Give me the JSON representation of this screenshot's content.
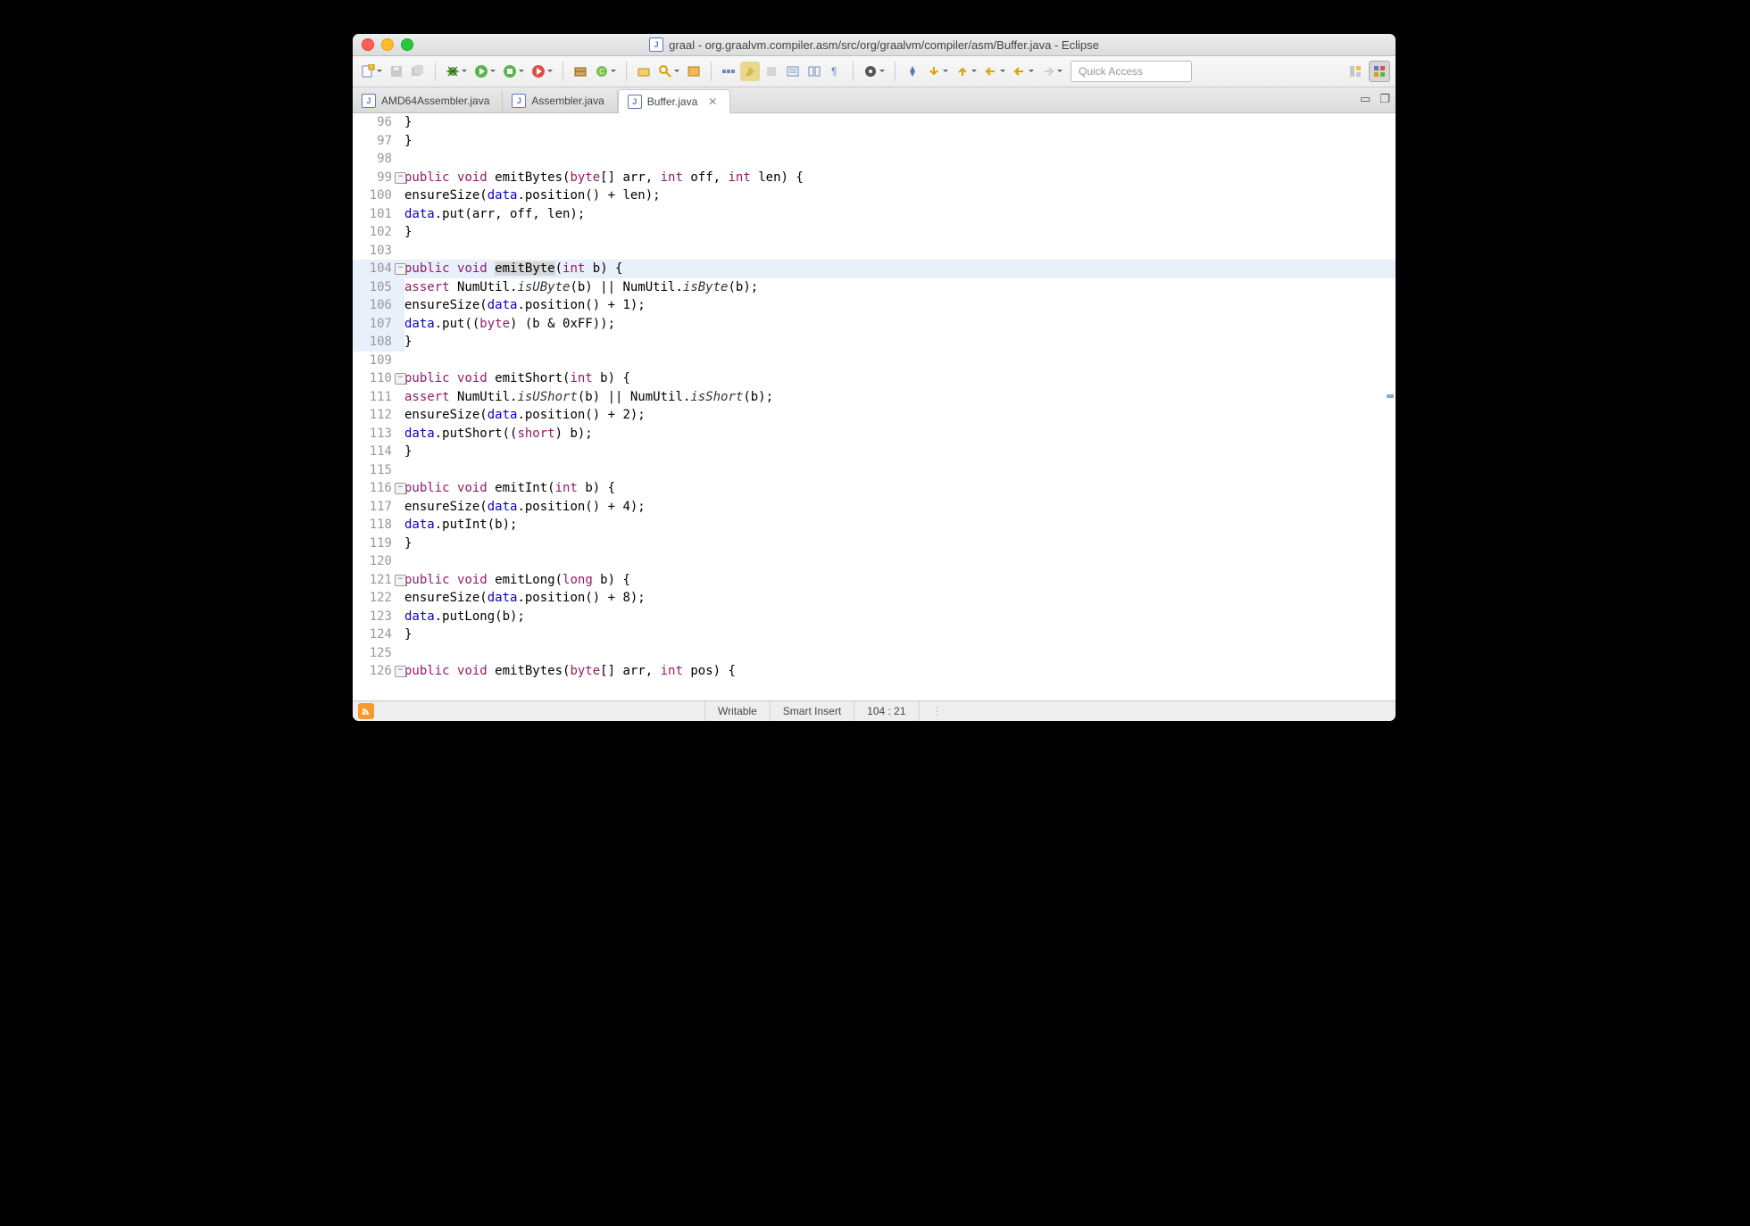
{
  "window_title": "graal - org.graalvm.compiler.asm/src/org/graalvm/compiler/asm/Buffer.java - Eclipse",
  "quick_access": "Quick Access",
  "tabs": [
    {
      "label": "AMD64Assembler.java",
      "active": false
    },
    {
      "label": "Assembler.java",
      "active": false
    },
    {
      "label": "Buffer.java",
      "active": true
    }
  ],
  "status": {
    "writable": "Writable",
    "insert": "Smart Insert",
    "pos": "104 : 21"
  },
  "lines": [
    {
      "n": "96",
      "mod": false,
      "fold": false,
      "hl": false,
      "html": "            }"
    },
    {
      "n": "97",
      "mod": false,
      "fold": false,
      "hl": false,
      "html": "        }"
    },
    {
      "n": "98",
      "mod": false,
      "fold": false,
      "hl": false,
      "html": ""
    },
    {
      "n": "99",
      "mod": false,
      "fold": true,
      "hl": false,
      "html": "        <span class='k'>public</span> <span class='k'>void</span> emitBytes(<span class='k'>byte</span>[] arr, <span class='k'>int</span> off, <span class='k'>int</span> len) {"
    },
    {
      "n": "100",
      "mod": false,
      "fold": false,
      "hl": false,
      "html": "            ensureSize(<span class='f'>data</span>.position() + len);"
    },
    {
      "n": "101",
      "mod": false,
      "fold": false,
      "hl": false,
      "html": "            <span class='f'>data</span>.put(arr, off, len);"
    },
    {
      "n": "102",
      "mod": false,
      "fold": false,
      "hl": false,
      "html": "        }"
    },
    {
      "n": "103",
      "mod": false,
      "fold": false,
      "hl": false,
      "html": ""
    },
    {
      "n": "104",
      "mod": true,
      "fold": true,
      "hl": true,
      "html": "        <span class='k'>public</span> <span class='k'>void</span> <span class='sel'>emitByte</span>(<span class='k'>int</span> b) {"
    },
    {
      "n": "105",
      "mod": true,
      "fold": false,
      "hl": false,
      "html": "            <span class='k'>assert</span> NumUtil.<span class='m'>isUByte</span>(b) || NumUtil.<span class='m'>isByte</span>(b);"
    },
    {
      "n": "106",
      "mod": true,
      "fold": false,
      "hl": false,
      "html": "            ensureSize(<span class='f'>data</span>.position() + 1);"
    },
    {
      "n": "107",
      "mod": true,
      "fold": false,
      "hl": false,
      "html": "            <span class='f'>data</span>.put((<span class='k'>byte</span>) (b & 0xFF));"
    },
    {
      "n": "108",
      "mod": true,
      "fold": false,
      "hl": false,
      "html": "        }"
    },
    {
      "n": "109",
      "mod": false,
      "fold": false,
      "hl": false,
      "html": ""
    },
    {
      "n": "110",
      "mod": false,
      "fold": true,
      "hl": false,
      "html": "        <span class='k'>public</span> <span class='k'>void</span> emitShort(<span class='k'>int</span> b) {"
    },
    {
      "n": "111",
      "mod": false,
      "fold": false,
      "hl": false,
      "html": "            <span class='k'>assert</span> NumUtil.<span class='m'>isUShort</span>(b) || NumUtil.<span class='m'>isShort</span>(b);"
    },
    {
      "n": "112",
      "mod": false,
      "fold": false,
      "hl": false,
      "html": "            ensureSize(<span class='f'>data</span>.position() + 2);"
    },
    {
      "n": "113",
      "mod": false,
      "fold": false,
      "hl": false,
      "html": "            <span class='f'>data</span>.putShort((<span class='k'>short</span>) b);"
    },
    {
      "n": "114",
      "mod": false,
      "fold": false,
      "hl": false,
      "html": "        }"
    },
    {
      "n": "115",
      "mod": false,
      "fold": false,
      "hl": false,
      "html": ""
    },
    {
      "n": "116",
      "mod": false,
      "fold": true,
      "hl": false,
      "html": "        <span class='k'>public</span> <span class='k'>void</span> emitInt(<span class='k'>int</span> b) {"
    },
    {
      "n": "117",
      "mod": false,
      "fold": false,
      "hl": false,
      "html": "            ensureSize(<span class='f'>data</span>.position() + 4);"
    },
    {
      "n": "118",
      "mod": false,
      "fold": false,
      "hl": false,
      "html": "            <span class='f'>data</span>.putInt(b);"
    },
    {
      "n": "119",
      "mod": false,
      "fold": false,
      "hl": false,
      "html": "        }"
    },
    {
      "n": "120",
      "mod": false,
      "fold": false,
      "hl": false,
      "html": ""
    },
    {
      "n": "121",
      "mod": false,
      "fold": true,
      "hl": false,
      "html": "        <span class='k'>public</span> <span class='k'>void</span> emitLong(<span class='k'>long</span> b) {"
    },
    {
      "n": "122",
      "mod": false,
      "fold": false,
      "hl": false,
      "html": "            ensureSize(<span class='f'>data</span>.position() + 8);"
    },
    {
      "n": "123",
      "mod": false,
      "fold": false,
      "hl": false,
      "html": "            <span class='f'>data</span>.putLong(b);"
    },
    {
      "n": "124",
      "mod": false,
      "fold": false,
      "hl": false,
      "html": "        }"
    },
    {
      "n": "125",
      "mod": false,
      "fold": false,
      "hl": false,
      "html": ""
    },
    {
      "n": "126",
      "mod": false,
      "fold": true,
      "hl": false,
      "html": "        <span class='k'>public</span> <span class='k'>void</span> emitBytes(<span class='k'>byte</span>[] arr, <span class='k'>int</span> pos) {"
    }
  ]
}
